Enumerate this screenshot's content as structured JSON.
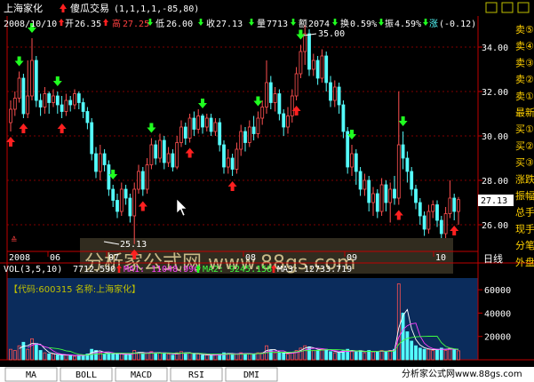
{
  "header": {
    "stock_name": "上海家化",
    "indicator_name": "傻瓜交易",
    "indicator_params": "(1,1,1,1,-85,80)",
    "date": "2008/10/10",
    "open_label": "开",
    "open": "26.35",
    "high_label": "高",
    "high": "27.25",
    "low_label": "低",
    "low": "26.00",
    "close_label": "收",
    "close": "27.13",
    "vol_label": "量",
    "vol": "7713",
    "amount_label": "额",
    "amount": "2074",
    "turnover_label": "换",
    "turnover": "0.59%",
    "amplitude_label": "振",
    "amplitude": "4.59%",
    "change_label": "涨",
    "change": "(-0.12)"
  },
  "price_axis": {
    "ticks": [
      "34.00",
      "32.00",
      "30.00",
      "28.00",
      "26.00"
    ],
    "current": "27.13"
  },
  "annotations": {
    "high_marker": "35.00",
    "low_marker": "25.13"
  },
  "months": [
    "2008",
    "06",
    "07",
    "08",
    "09",
    "10"
  ],
  "period_label": "日线",
  "watermark": "分析家公式网 www.88gs.com",
  "volume_panel": {
    "title": "VOL(3,5,10)",
    "vol": "7712.590",
    "ma1_label": "MA1:",
    "ma1": "11048.996",
    "ma2_label": "MA2:",
    "ma2": "9245.158",
    "ma3_label": "MA3:",
    "ma3": "12733.719",
    "info": "【代码:600315 名称:上海家化】",
    "axis_ticks": [
      "60000",
      "40000",
      "20000"
    ]
  },
  "side_labels": [
    "卖⑤",
    "卖④",
    "卖③",
    "卖②",
    "卖①",
    "最新",
    "买①",
    "买②",
    "买③",
    "涨跌",
    "振幅",
    "总手",
    "现手",
    "分笔",
    "外盘"
  ],
  "tabs": [
    "MA",
    "BOLL",
    "MACD",
    "RSI",
    "DMI"
  ],
  "footer_text": "分析家公式网www.88gs.com",
  "colors": {
    "up": "#ff5050",
    "down": "#54fcfc",
    "buy": "#ff2020",
    "sell": "#20ff20",
    "grid": "#800000"
  },
  "chart_data": {
    "type": "candlestick",
    "price_range": [
      24.8,
      35.4
    ],
    "volume_range": [
      0,
      70000
    ],
    "candles": [
      {
        "o": 30.6,
        "c": 31.2,
        "h": 31.6,
        "l": 30.2,
        "v": 9000
      },
      {
        "o": 31.2,
        "c": 31.7,
        "h": 32.0,
        "l": 30.9,
        "v": 8000
      },
      {
        "o": 31.7,
        "c": 32.6,
        "h": 32.9,
        "l": 31.5,
        "v": 12000
      },
      {
        "o": 32.6,
        "c": 31.0,
        "h": 32.8,
        "l": 30.8,
        "v": 15000
      },
      {
        "o": 31.0,
        "c": 31.8,
        "h": 33.4,
        "l": 30.8,
        "v": 9000
      },
      {
        "o": 31.8,
        "c": 33.4,
        "h": 34.4,
        "l": 31.6,
        "v": 18000
      },
      {
        "o": 33.4,
        "c": 31.6,
        "h": 33.6,
        "l": 31.3,
        "v": 14000
      },
      {
        "o": 31.6,
        "c": 31.3,
        "h": 31.9,
        "l": 30.9,
        "v": 8000
      },
      {
        "o": 31.3,
        "c": 31.9,
        "h": 32.2,
        "l": 31.0,
        "v": 6000
      },
      {
        "o": 31.9,
        "c": 31.5,
        "h": 32.0,
        "l": 31.0,
        "v": 5000
      },
      {
        "o": 31.5,
        "c": 31.8,
        "h": 32.1,
        "l": 31.3,
        "v": 5000
      },
      {
        "o": 31.8,
        "c": 31.4,
        "h": 32.0,
        "l": 31.0,
        "v": 4000
      },
      {
        "o": 31.4,
        "c": 31.1,
        "h": 31.8,
        "l": 30.8,
        "v": 4000
      },
      {
        "o": 31.1,
        "c": 31.6,
        "h": 31.9,
        "l": 30.9,
        "v": 4000
      },
      {
        "o": 31.6,
        "c": 31.4,
        "h": 31.8,
        "l": 31.1,
        "v": 4000
      },
      {
        "o": 31.4,
        "c": 31.9,
        "h": 32.1,
        "l": 31.2,
        "v": 3000
      },
      {
        "o": 31.9,
        "c": 31.5,
        "h": 32.0,
        "l": 31.2,
        "v": 4000
      },
      {
        "o": 31.5,
        "c": 31.1,
        "h": 31.7,
        "l": 30.8,
        "v": 4000
      },
      {
        "o": 31.1,
        "c": 30.6,
        "h": 31.3,
        "l": 30.3,
        "v": 5000
      },
      {
        "o": 30.6,
        "c": 29.2,
        "h": 30.8,
        "l": 28.9,
        "v": 9000
      },
      {
        "o": 29.2,
        "c": 28.4,
        "h": 29.5,
        "l": 28.1,
        "v": 8000
      },
      {
        "o": 28.4,
        "c": 29.2,
        "h": 29.6,
        "l": 28.0,
        "v": 6000
      },
      {
        "o": 29.2,
        "c": 28.7,
        "h": 29.4,
        "l": 28.4,
        "v": 5000
      },
      {
        "o": 28.7,
        "c": 27.6,
        "h": 28.9,
        "l": 27.3,
        "v": 6000
      },
      {
        "o": 27.6,
        "c": 27.1,
        "h": 27.8,
        "l": 26.8,
        "v": 5000
      },
      {
        "o": 27.1,
        "c": 26.6,
        "h": 27.4,
        "l": 26.3,
        "v": 5000
      },
      {
        "o": 26.6,
        "c": 27.6,
        "h": 27.9,
        "l": 26.4,
        "v": 5000
      },
      {
        "o": 27.6,
        "c": 27.2,
        "h": 27.8,
        "l": 26.9,
        "v": 4000
      },
      {
        "o": 27.2,
        "c": 26.4,
        "h": 27.4,
        "l": 26.1,
        "v": 5000
      },
      {
        "o": 26.4,
        "c": 27.6,
        "h": 27.9,
        "l": 25.13,
        "v": 8000
      },
      {
        "o": 27.6,
        "c": 28.4,
        "h": 28.7,
        "l": 27.4,
        "v": 6000
      },
      {
        "o": 28.4,
        "c": 27.6,
        "h": 28.6,
        "l": 27.3,
        "v": 5000
      },
      {
        "o": 27.6,
        "c": 28.7,
        "h": 29.0,
        "l": 27.4,
        "v": 6000
      },
      {
        "o": 28.7,
        "c": 29.6,
        "h": 29.9,
        "l": 28.5,
        "v": 7000
      },
      {
        "o": 29.6,
        "c": 29.0,
        "h": 29.8,
        "l": 28.7,
        "v": 5000
      },
      {
        "o": 29.0,
        "c": 29.8,
        "h": 30.1,
        "l": 28.8,
        "v": 6000
      },
      {
        "o": 29.8,
        "c": 28.8,
        "h": 30.0,
        "l": 28.5,
        "v": 6000
      },
      {
        "o": 28.8,
        "c": 29.2,
        "h": 29.5,
        "l": 28.6,
        "v": 5000
      },
      {
        "o": 29.2,
        "c": 28.6,
        "h": 29.4,
        "l": 28.4,
        "v": 4000
      },
      {
        "o": 28.6,
        "c": 29.7,
        "h": 30.0,
        "l": 28.5,
        "v": 6000
      },
      {
        "o": 29.7,
        "c": 30.4,
        "h": 30.7,
        "l": 29.5,
        "v": 7000
      },
      {
        "o": 30.4,
        "c": 29.9,
        "h": 30.6,
        "l": 29.6,
        "v": 5000
      },
      {
        "o": 29.9,
        "c": 30.8,
        "h": 31.0,
        "l": 29.7,
        "v": 6000
      },
      {
        "o": 30.8,
        "c": 30.3,
        "h": 31.1,
        "l": 30.0,
        "v": 5000
      },
      {
        "o": 30.3,
        "c": 30.9,
        "h": 31.2,
        "l": 30.1,
        "v": 5000
      },
      {
        "o": 30.9,
        "c": 30.4,
        "h": 31.0,
        "l": 30.1,
        "v": 4000
      },
      {
        "o": 30.4,
        "c": 30.8,
        "h": 31.0,
        "l": 30.2,
        "v": 4000
      },
      {
        "o": 30.8,
        "c": 30.2,
        "h": 31.0,
        "l": 30.0,
        "v": 4000
      },
      {
        "o": 30.2,
        "c": 30.6,
        "h": 30.8,
        "l": 30.0,
        "v": 4000
      },
      {
        "o": 30.6,
        "c": 29.6,
        "h": 30.8,
        "l": 29.3,
        "v": 5000
      },
      {
        "o": 29.6,
        "c": 28.6,
        "h": 29.8,
        "l": 28.3,
        "v": 6000
      },
      {
        "o": 28.6,
        "c": 29.0,
        "h": 29.4,
        "l": 28.3,
        "v": 5000
      },
      {
        "o": 29.0,
        "c": 28.5,
        "h": 29.2,
        "l": 28.2,
        "v": 5000
      },
      {
        "o": 28.5,
        "c": 29.4,
        "h": 29.7,
        "l": 28.3,
        "v": 5000
      },
      {
        "o": 29.4,
        "c": 30.2,
        "h": 30.5,
        "l": 29.1,
        "v": 6000
      },
      {
        "o": 30.2,
        "c": 29.7,
        "h": 30.4,
        "l": 29.3,
        "v": 5000
      },
      {
        "o": 29.7,
        "c": 30.4,
        "h": 30.7,
        "l": 29.5,
        "v": 5000
      },
      {
        "o": 30.4,
        "c": 30.1,
        "h": 30.9,
        "l": 29.8,
        "v": 5000
      },
      {
        "o": 30.1,
        "c": 30.8,
        "h": 31.1,
        "l": 29.9,
        "v": 6000
      },
      {
        "o": 30.8,
        "c": 31.3,
        "h": 31.6,
        "l": 30.5,
        "v": 6000
      },
      {
        "o": 31.3,
        "c": 32.4,
        "h": 33.4,
        "l": 31.0,
        "v": 12000
      },
      {
        "o": 32.4,
        "c": 31.5,
        "h": 32.7,
        "l": 31.2,
        "v": 8000
      },
      {
        "o": 31.5,
        "c": 31.9,
        "h": 32.2,
        "l": 31.1,
        "v": 6000
      },
      {
        "o": 31.9,
        "c": 31.0,
        "h": 32.1,
        "l": 30.7,
        "v": 6000
      },
      {
        "o": 31.0,
        "c": 30.4,
        "h": 31.2,
        "l": 30.0,
        "v": 6000
      },
      {
        "o": 30.4,
        "c": 30.9,
        "h": 31.3,
        "l": 30.1,
        "v": 5000
      },
      {
        "o": 30.9,
        "c": 31.8,
        "h": 32.1,
        "l": 30.6,
        "v": 6000
      },
      {
        "o": 31.8,
        "c": 32.8,
        "h": 33.1,
        "l": 31.6,
        "v": 8000
      },
      {
        "o": 32.8,
        "c": 33.8,
        "h": 34.1,
        "l": 32.6,
        "v": 10000
      },
      {
        "o": 33.8,
        "c": 34.6,
        "h": 35.0,
        "l": 33.2,
        "v": 12000
      },
      {
        "o": 34.6,
        "c": 33.0,
        "h": 34.8,
        "l": 32.7,
        "v": 11000
      },
      {
        "o": 33.0,
        "c": 33.4,
        "h": 33.7,
        "l": 32.7,
        "v": 8000
      },
      {
        "o": 33.4,
        "c": 32.6,
        "h": 33.6,
        "l": 32.3,
        "v": 8000
      },
      {
        "o": 32.6,
        "c": 33.6,
        "h": 33.9,
        "l": 32.4,
        "v": 9000
      },
      {
        "o": 33.6,
        "c": 32.4,
        "h": 33.8,
        "l": 32.0,
        "v": 9000
      },
      {
        "o": 32.4,
        "c": 31.6,
        "h": 32.7,
        "l": 31.3,
        "v": 7000
      },
      {
        "o": 31.6,
        "c": 32.2,
        "h": 32.5,
        "l": 31.3,
        "v": 6000
      },
      {
        "o": 32.2,
        "c": 31.4,
        "h": 32.4,
        "l": 31.0,
        "v": 6000
      },
      {
        "o": 31.4,
        "c": 30.2,
        "h": 31.6,
        "l": 29.9,
        "v": 8000
      },
      {
        "o": 30.2,
        "c": 28.6,
        "h": 30.4,
        "l": 28.3,
        "v": 9000
      },
      {
        "o": 28.6,
        "c": 29.2,
        "h": 29.6,
        "l": 28.2,
        "v": 7000
      },
      {
        "o": 29.2,
        "c": 28.4,
        "h": 29.4,
        "l": 27.8,
        "v": 7000
      },
      {
        "o": 28.4,
        "c": 27.6,
        "h": 28.6,
        "l": 27.3,
        "v": 8000
      },
      {
        "o": 27.6,
        "c": 28.0,
        "h": 28.3,
        "l": 27.3,
        "v": 6000
      },
      {
        "o": 28.0,
        "c": 27.0,
        "h": 28.2,
        "l": 26.6,
        "v": 8000
      },
      {
        "o": 27.0,
        "c": 27.4,
        "h": 27.7,
        "l": 26.4,
        "v": 7000
      },
      {
        "o": 27.4,
        "c": 26.6,
        "h": 27.6,
        "l": 26.3,
        "v": 7000
      },
      {
        "o": 26.6,
        "c": 27.8,
        "h": 28.1,
        "l": 26.4,
        "v": 8000
      },
      {
        "o": 27.8,
        "c": 27.0,
        "h": 28.0,
        "l": 26.6,
        "v": 7000
      },
      {
        "o": 27.0,
        "c": 27.6,
        "h": 27.9,
        "l": 26.1,
        "v": 8000
      },
      {
        "o": 27.6,
        "c": 27.2,
        "h": 28.2,
        "l": 26.9,
        "v": 9000
      },
      {
        "o": 27.2,
        "c": 29.6,
        "h": 32.0,
        "l": 26.9,
        "v": 65000
      },
      {
        "o": 29.6,
        "c": 29.0,
        "h": 30.2,
        "l": 28.5,
        "v": 40000
      },
      {
        "o": 29.0,
        "c": 28.4,
        "h": 29.3,
        "l": 27.9,
        "v": 24000
      },
      {
        "o": 28.4,
        "c": 27.6,
        "h": 28.6,
        "l": 27.3,
        "v": 16000
      },
      {
        "o": 27.6,
        "c": 27.0,
        "h": 27.8,
        "l": 26.7,
        "v": 12000
      },
      {
        "o": 27.0,
        "c": 26.4,
        "h": 27.2,
        "l": 26.0,
        "v": 10000
      },
      {
        "o": 26.4,
        "c": 25.8,
        "h": 26.6,
        "l": 25.5,
        "v": 9000
      },
      {
        "o": 25.8,
        "c": 26.6,
        "h": 26.9,
        "l": 25.6,
        "v": 9000
      },
      {
        "o": 26.6,
        "c": 26.9,
        "h": 27.1,
        "l": 26.3,
        "v": 8000
      },
      {
        "o": 26.9,
        "c": 26.2,
        "h": 27.1,
        "l": 25.9,
        "v": 9000
      },
      {
        "o": 26.2,
        "c": 25.6,
        "h": 26.4,
        "l": 25.4,
        "v": 10000
      },
      {
        "o": 25.6,
        "c": 26.5,
        "h": 26.8,
        "l": 25.4,
        "v": 8000
      },
      {
        "o": 26.5,
        "c": 27.2,
        "h": 28.0,
        "l": 26.3,
        "v": 10000
      },
      {
        "o": 27.2,
        "c": 26.6,
        "h": 27.4,
        "l": 26.2,
        "v": 9000
      },
      {
        "o": 26.6,
        "c": 27.13,
        "h": 27.25,
        "l": 26.0,
        "v": 7713
      }
    ],
    "buy_signals": [
      0,
      3,
      12,
      29,
      31,
      42,
      52,
      67,
      91,
      104
    ],
    "sell_signals": [
      2,
      5,
      11,
      24,
      33,
      45,
      58,
      68,
      80,
      92
    ]
  }
}
